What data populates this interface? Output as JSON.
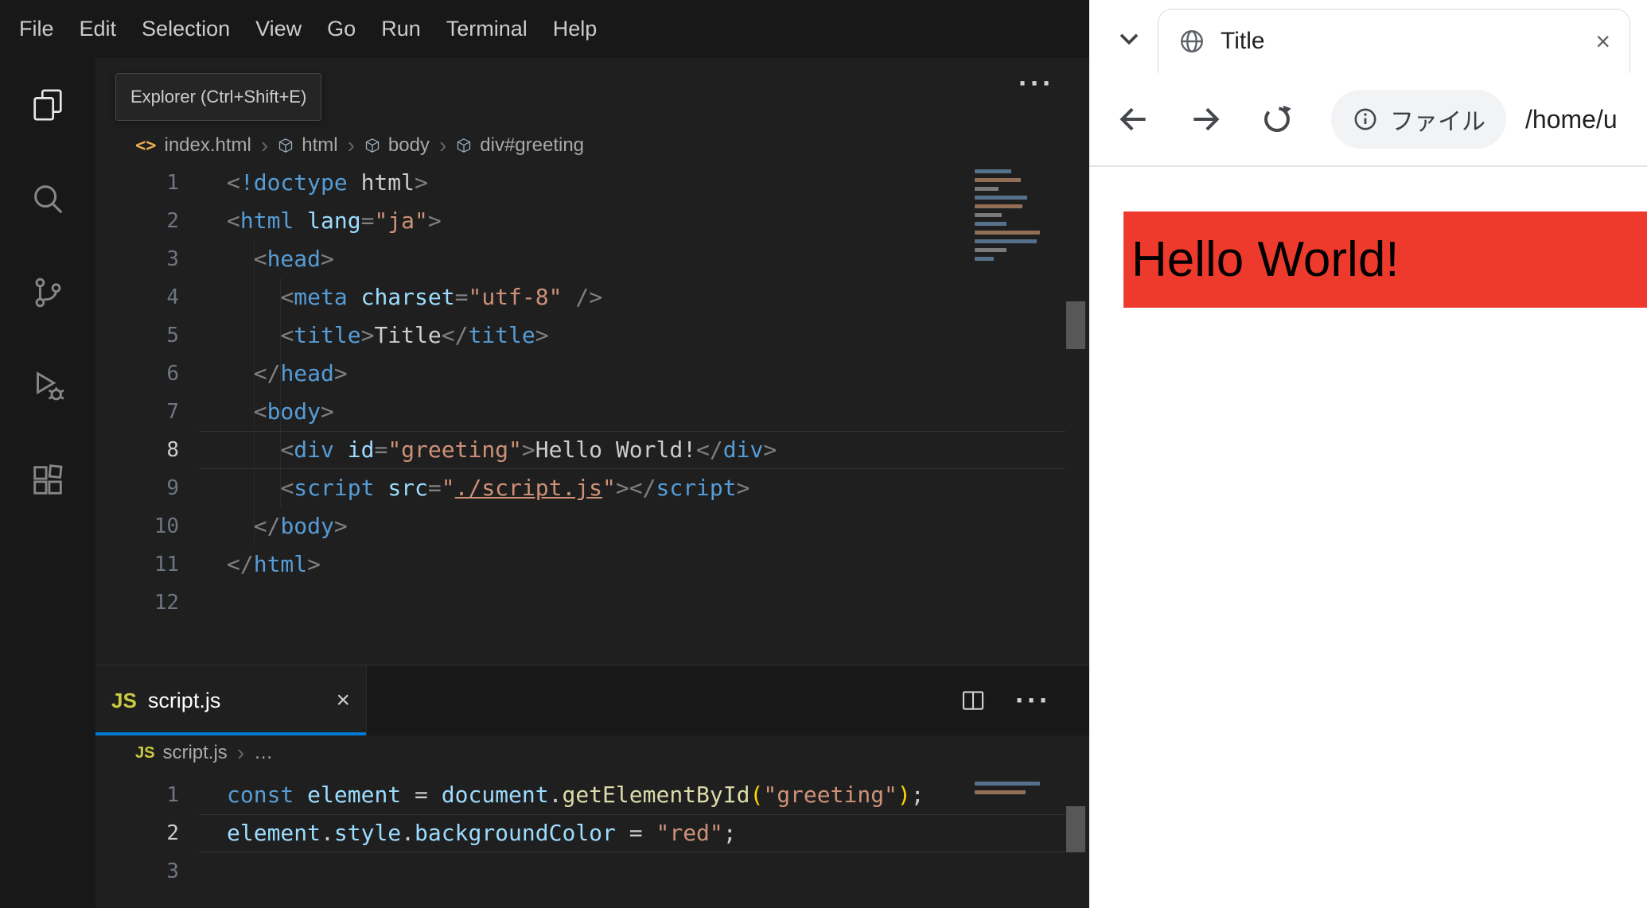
{
  "vscode": {
    "menu_items": [
      "File",
      "Edit",
      "Selection",
      "View",
      "Go",
      "Run",
      "Terminal",
      "Help"
    ],
    "tooltip": "Explorer (Ctrl+Shift+E)",
    "colors": {
      "accent": "#0078d4",
      "js_icon": "#cbcb41",
      "html_icon": "#e8ab53",
      "editor_bg": "#1f1f1f",
      "chrome_bg": "#181818"
    },
    "html_editor": {
      "more_actions_glyph": "···",
      "breadcrumb": {
        "file_icon_glyph": "<>",
        "file": "index.html",
        "separator_glyph": "›",
        "segments": [
          "html",
          "body",
          "div#greeting"
        ]
      },
      "active_line": 8,
      "lines": [
        {
          "n": "1",
          "t": [
            [
              "<",
              "pu"
            ],
            [
              "!doctype",
              "tag"
            ],
            [
              " html",
              "txt"
            ],
            [
              ">",
              "pu"
            ]
          ]
        },
        {
          "n": "2",
          "t": [
            [
              "<",
              "pu"
            ],
            [
              "html",
              "tag"
            ],
            [
              " ",
              "txt"
            ],
            [
              "lang",
              "attr"
            ],
            [
              "=",
              "pu"
            ],
            [
              "\"ja\"",
              "str"
            ],
            [
              ">",
              "pu"
            ]
          ]
        },
        {
          "n": "3",
          "t": [
            [
              "  ",
              "txt"
            ],
            [
              "<",
              "pu"
            ],
            [
              "head",
              "tag"
            ],
            [
              ">",
              "pu"
            ]
          ]
        },
        {
          "n": "4",
          "t": [
            [
              "    ",
              "txt"
            ],
            [
              "<",
              "pu"
            ],
            [
              "meta",
              "tag"
            ],
            [
              " ",
              "txt"
            ],
            [
              "charset",
              "attr"
            ],
            [
              "=",
              "pu"
            ],
            [
              "\"utf-8\"",
              "str"
            ],
            [
              " ",
              "txt"
            ],
            [
              "/>",
              "pu"
            ]
          ]
        },
        {
          "n": "5",
          "t": [
            [
              "    ",
              "txt"
            ],
            [
              "<",
              "pu"
            ],
            [
              "title",
              "tag"
            ],
            [
              ">",
              "pu"
            ],
            [
              "Title",
              "txt"
            ],
            [
              "<",
              "pu"
            ],
            [
              "/",
              "pu"
            ],
            [
              "title",
              "tag"
            ],
            [
              ">",
              "pu"
            ]
          ]
        },
        {
          "n": "6",
          "t": [
            [
              "  ",
              "txt"
            ],
            [
              "<",
              "pu"
            ],
            [
              "/",
              "pu"
            ],
            [
              "head",
              "tag"
            ],
            [
              ">",
              "pu"
            ]
          ]
        },
        {
          "n": "7",
          "t": [
            [
              "  ",
              "txt"
            ],
            [
              "<",
              "pu"
            ],
            [
              "body",
              "tag"
            ],
            [
              ">",
              "pu"
            ]
          ]
        },
        {
          "n": "8",
          "t": [
            [
              "    ",
              "txt"
            ],
            [
              "<",
              "pu"
            ],
            [
              "div",
              "tag"
            ],
            [
              " ",
              "txt"
            ],
            [
              "id",
              "attr"
            ],
            [
              "=",
              "pu"
            ],
            [
              "\"greeting\"",
              "str"
            ],
            [
              ">",
              "pu"
            ],
            [
              "Hello World!",
              "txt"
            ],
            [
              "<",
              "pu"
            ],
            [
              "/",
              "pu"
            ],
            [
              "div",
              "tag"
            ],
            [
              ">",
              "pu"
            ]
          ]
        },
        {
          "n": "9",
          "t": [
            [
              "    ",
              "txt"
            ],
            [
              "<",
              "pu"
            ],
            [
              "script",
              "tag"
            ],
            [
              " ",
              "txt"
            ],
            [
              "src",
              "attr"
            ],
            [
              "=",
              "pu"
            ],
            [
              "\"",
              "str"
            ],
            [
              "./script.js",
              "lnk"
            ],
            [
              "\"",
              "str"
            ],
            [
              ">",
              "pu"
            ],
            [
              "<",
              "pu"
            ],
            [
              "/",
              "pu"
            ],
            [
              "script",
              "tag"
            ],
            [
              ">",
              "pu"
            ]
          ]
        },
        {
          "n": "10",
          "t": [
            [
              "  ",
              "txt"
            ],
            [
              "<",
              "pu"
            ],
            [
              "/",
              "pu"
            ],
            [
              "body",
              "tag"
            ],
            [
              ">",
              "pu"
            ]
          ]
        },
        {
          "n": "11",
          "t": [
            [
              "<",
              "pu"
            ],
            [
              "/",
              "pu"
            ],
            [
              "html",
              "tag"
            ],
            [
              ">",
              "pu"
            ]
          ]
        },
        {
          "n": "12",
          "t": []
        }
      ]
    },
    "script_tab": {
      "icon_label": "JS",
      "label": "script.js",
      "close_glyph": "×",
      "more_actions_glyph": "···"
    },
    "js_editor": {
      "breadcrumb": {
        "icon_label": "JS",
        "file": "script.js",
        "separator_glyph": "›",
        "ellipsis_glyph": "…"
      },
      "active_line": 2,
      "lines": [
        {
          "n": "1",
          "t": [
            [
              "const",
              "kw"
            ],
            [
              " ",
              "txt"
            ],
            [
              "element",
              "var"
            ],
            [
              " ",
              "txt"
            ],
            [
              "=",
              "txt"
            ],
            [
              " ",
              "txt"
            ],
            [
              "document",
              "var"
            ],
            [
              ".",
              "txt"
            ],
            [
              "getElementById",
              "fn"
            ],
            [
              "(",
              "br"
            ],
            [
              "\"greeting\"",
              "str"
            ],
            [
              ")",
              "br"
            ],
            [
              ";",
              "txt"
            ]
          ]
        },
        {
          "n": "2",
          "t": [
            [
              "element",
              "var"
            ],
            [
              ".",
              "txt"
            ],
            [
              "style",
              "var"
            ],
            [
              ".",
              "txt"
            ],
            [
              "backgroundColor",
              "var"
            ],
            [
              " ",
              "txt"
            ],
            [
              "=",
              "txt"
            ],
            [
              " ",
              "txt"
            ],
            [
              "\"red\"",
              "str"
            ],
            [
              ";",
              "txt"
            ]
          ]
        },
        {
          "n": "3",
          "t": []
        }
      ]
    }
  },
  "browser": {
    "tab": {
      "title": "Title",
      "close_glyph": "×"
    },
    "toolbar": {
      "chip_label": "ファイル",
      "url": "/home/u"
    },
    "page": {
      "greeting": "Hello World!",
      "banner_color": "#ee3a2c",
      "text_color": "#000000"
    }
  }
}
